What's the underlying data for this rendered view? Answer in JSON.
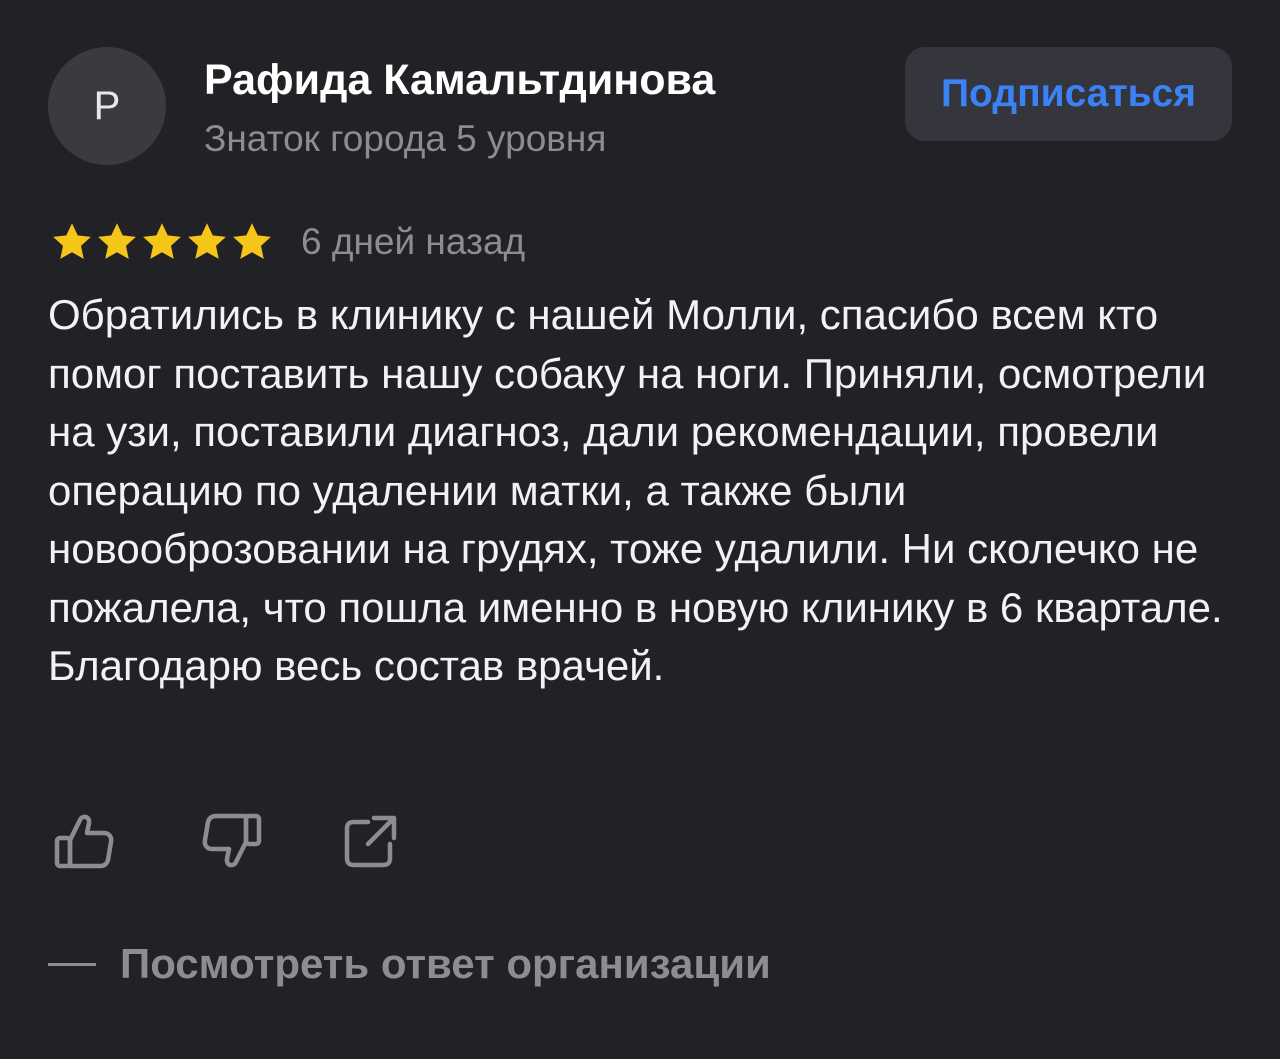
{
  "author": {
    "avatar_letter": "Р",
    "name": "Рафида Камальтдинова",
    "level": "Знаток города 5 уровня"
  },
  "subscribe": {
    "label": "Подписаться",
    "color": "#3b82f6"
  },
  "review": {
    "rating": 5,
    "max_rating": 5,
    "star_color": "#f5c518",
    "date": "6 дней назад",
    "text": "Обратились в клинику с нашей Молли, спасибо всем кто помог поставить нашу собаку на ноги. Приняли, осмотрели на узи, поставили диагноз, дали рекомендации, провели операцию по удалении матки, а также были новооброзовании на грудях, тоже удалили. Ни сколечко не пожалела, что пошла именно в новую клинику в 6 квартале. Благодарю весь состав врачей."
  },
  "actions": {
    "icons": [
      "thumbs-up-icon",
      "thumbs-down-icon",
      "share-icon"
    ]
  },
  "org_reply": {
    "label": "Посмотреть ответ организации"
  }
}
